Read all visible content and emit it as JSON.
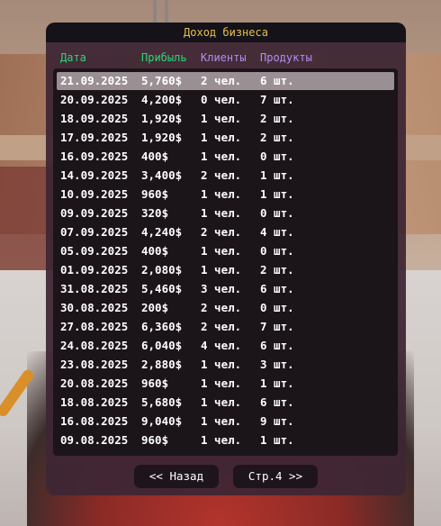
{
  "window": {
    "title": "Доход бизнеса"
  },
  "columns": {
    "date": "Дата",
    "profit": "Прибыль",
    "clients": "Клиенты",
    "products": "Продукты"
  },
  "rows": [
    {
      "date": "21.09.2025",
      "profit": "5,760$",
      "clients": "2 чел.",
      "products": "6 шт."
    },
    {
      "date": "20.09.2025",
      "profit": "4,200$",
      "clients": "0 чел.",
      "products": "7 шт."
    },
    {
      "date": "18.09.2025",
      "profit": "1,920$",
      "clients": "1 чел.",
      "products": "2 шт."
    },
    {
      "date": "17.09.2025",
      "profit": "1,920$",
      "clients": "1 чел.",
      "products": "2 шт."
    },
    {
      "date": "16.09.2025",
      "profit": "400$",
      "clients": "1 чел.",
      "products": "0 шт."
    },
    {
      "date": "14.09.2025",
      "profit": "3,400$",
      "clients": "2 чел.",
      "products": "1 шт."
    },
    {
      "date": "10.09.2025",
      "profit": "960$",
      "clients": "1 чел.",
      "products": "1 шт."
    },
    {
      "date": "09.09.2025",
      "profit": "320$",
      "clients": "1 чел.",
      "products": "0 шт."
    },
    {
      "date": "07.09.2025",
      "profit": "4,240$",
      "clients": "2 чел.",
      "products": "4 шт."
    },
    {
      "date": "05.09.2025",
      "profit": "400$",
      "clients": "1 чел.",
      "products": "0 шт."
    },
    {
      "date": "01.09.2025",
      "profit": "2,080$",
      "clients": "1 чел.",
      "products": "2 шт."
    },
    {
      "date": "31.08.2025",
      "profit": "5,460$",
      "clients": "3 чел.",
      "products": "6 шт."
    },
    {
      "date": "30.08.2025",
      "profit": "200$",
      "clients": "2 чел.",
      "products": "0 шт."
    },
    {
      "date": "27.08.2025",
      "profit": "6,360$",
      "clients": "2 чел.",
      "products": "7 шт."
    },
    {
      "date": "24.08.2025",
      "profit": "6,040$",
      "clients": "4 чел.",
      "products": "6 шт."
    },
    {
      "date": "23.08.2025",
      "profit": "2,880$",
      "clients": "1 чел.",
      "products": "3 шт."
    },
    {
      "date": "20.08.2025",
      "profit": "960$",
      "clients": "1 чел.",
      "products": "1 шт."
    },
    {
      "date": "18.08.2025",
      "profit": "5,680$",
      "clients": "1 чел.",
      "products": "6 шт."
    },
    {
      "date": "16.08.2025",
      "profit": "9,040$",
      "clients": "1 чел.",
      "products": "9 шт."
    },
    {
      "date": "09.08.2025",
      "profit": "960$",
      "clients": "1 чел.",
      "products": "1 шт."
    }
  ],
  "selected_row": 0,
  "buttons": {
    "back": "<< Назад",
    "next": "Стр.4 >>"
  },
  "colors": {
    "title": "#e5c04a",
    "header_green": "#2fd47a",
    "header_purple": "#b48cf2"
  }
}
